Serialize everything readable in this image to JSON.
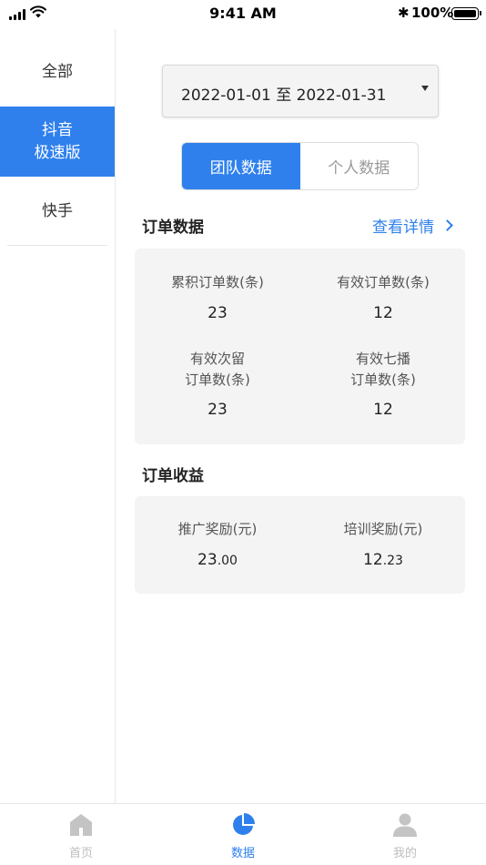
{
  "status_bar": {
    "time": "9:41 AM",
    "battery": "100%"
  },
  "sidebar": {
    "items": [
      {
        "label": "全部"
      },
      {
        "label_lines": [
          "抖音",
          "极速版"
        ]
      },
      {
        "label": "快手"
      }
    ]
  },
  "date_range": {
    "value": "2022-01-01 至 2022-01-31"
  },
  "segment": {
    "team": "团队数据",
    "personal": "个人数据"
  },
  "orders": {
    "title": "订单数据",
    "detail_link": "查看详情",
    "stats": [
      {
        "label": "累积订单数(条)",
        "value": "23"
      },
      {
        "label": "有效订单数(条)",
        "value": "12"
      },
      {
        "label_lines": [
          "有效次留",
          "订单数(条)"
        ],
        "value": "23"
      },
      {
        "label_lines": [
          "有效七播",
          "订单数(条)"
        ],
        "value": "12"
      }
    ]
  },
  "income": {
    "title": "订单收益",
    "stats": [
      {
        "label": "推广奖励(元)",
        "value_int": "23",
        "value_dec": ".00"
      },
      {
        "label": "培训奖励(元)",
        "value_int": "12",
        "value_dec": ".23"
      }
    ]
  },
  "tabbar": {
    "tabs": [
      {
        "label": "首页",
        "icon": "home-icon"
      },
      {
        "label": "数据",
        "icon": "pie-chart-icon"
      },
      {
        "label": "我的",
        "icon": "user-icon"
      }
    ],
    "active_color": "#2f80ed",
    "inactive_color": "#bdbdbd"
  },
  "colors": {
    "accent": "#2f80ed",
    "card_bg": "#f4f4f4"
  }
}
